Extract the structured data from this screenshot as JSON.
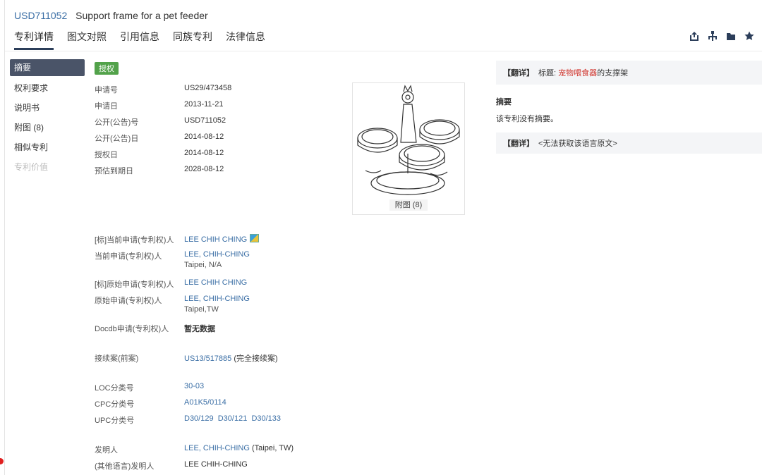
{
  "header": {
    "patent_number": "USD711052",
    "patent_title": "Support frame for a pet feeder",
    "tabs": [
      "专利详情",
      "图文对照",
      "引用信息",
      "同族专利",
      "法律信息"
    ]
  },
  "toolbar_icons": [
    "export-icon",
    "tree-icon",
    "folder-icon",
    "star-icon"
  ],
  "sidebar": {
    "items": [
      "摘要",
      "权利要求",
      "说明书",
      "附图 (8)",
      "相似专利",
      "专利价值"
    ]
  },
  "status_badge": "授权",
  "basic_info": [
    {
      "label": "申请号",
      "value": "US29/473458"
    },
    {
      "label": "申请日",
      "value": "2013-11-21"
    },
    {
      "label": "公开(公告)号",
      "value": "USD711052"
    },
    {
      "label": "公开(公告)日",
      "value": "2014-08-12"
    },
    {
      "label": "授权日",
      "value": "2014-08-12"
    },
    {
      "label": "预估到期日",
      "value": "2028-08-12"
    }
  ],
  "parties": {
    "std_current_label": "[标]当前申请(专利权)人",
    "std_current_value": "LEE CHIH CHING",
    "current_label": "当前申请(专利权)人",
    "current_value": "LEE, CHIH-CHING",
    "current_location": "Taipei, N/A",
    "std_original_label": "[标]原始申请(专利权)人",
    "std_original_value": "LEE CHIH CHING",
    "original_label": "原始申请(专利权)人",
    "original_value": "LEE, CHIH-CHING",
    "original_location": "Taipei,TW",
    "docdb_label": "Docdb申请(专利权)人",
    "docdb_value": "暂无数据"
  },
  "continuation": {
    "label": "接续案(前案)",
    "link": "US13/517885",
    "note": "(完全接续案)"
  },
  "classification": {
    "loc_label": "LOC分类号",
    "loc_value": "30-03",
    "cpc_label": "CPC分类号",
    "cpc_value": "A01K5/0114",
    "upc_label": "UPC分类号",
    "upc_values": [
      "D30/129",
      "D30/121",
      "D30/133"
    ]
  },
  "inventors": {
    "inventor_label": "发明人",
    "inventor_value": "LEE, CHIH-CHING",
    "inventor_location": "(Taipei, TW)",
    "other_lang_label": "(其他语言)发明人",
    "other_lang_value": "LEE CHIH-CHING"
  },
  "figure": {
    "label": "附图 (8)"
  },
  "right_panel": {
    "translate_tag": "【翻详】",
    "title_prefix": "标题:",
    "title_highlight": "宠物喂食器",
    "title_suffix": "的支撑架",
    "abstract_title": "摘要",
    "abstract_text": "该专利没有摘要。",
    "translate_tag2": "【翻详】",
    "unavailable_text": "<无法获取该语言原文>"
  }
}
